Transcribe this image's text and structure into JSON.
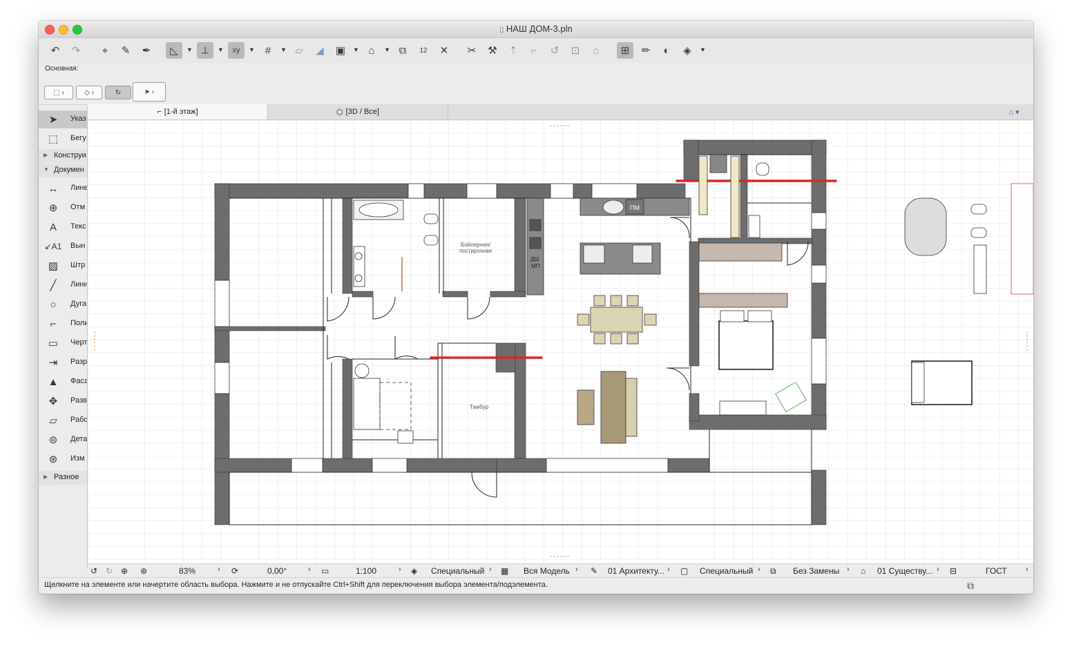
{
  "window": {
    "title": "НАШ ДОМ-3.pln"
  },
  "infobox": {
    "label": "Основная:"
  },
  "toolbox": {
    "items": [
      {
        "label": "Указ"
      },
      {
        "label": "Бегу"
      }
    ],
    "groups": [
      {
        "label": "Конструи"
      },
      {
        "label": "Докумен"
      }
    ],
    "doc_items": [
      {
        "label": "Лине"
      },
      {
        "label": "Отм"
      },
      {
        "label": "Текс"
      },
      {
        "label": "Вын"
      },
      {
        "label": "Штр"
      },
      {
        "label": "Лини"
      },
      {
        "label": "Дуга"
      },
      {
        "label": "Поли"
      },
      {
        "label": "Черт"
      },
      {
        "label": "Разр"
      },
      {
        "label": "Фаса"
      },
      {
        "label": "Разв"
      },
      {
        "label": "Рабо"
      },
      {
        "label": "Дета"
      },
      {
        "label": "Изм"
      }
    ],
    "footer_group": {
      "label": "Разное"
    }
  },
  "tabs": [
    {
      "label": "[1-й этаж]"
    },
    {
      "label": "[3D / Все]"
    }
  ],
  "plan": {
    "labels": {
      "boiler": "Бойлерная/",
      "boiler2": "постирочная",
      "tambur": "Тамбур",
      "pm": "ПМ",
      "dsh": "ДШ",
      "mp": "МП"
    }
  },
  "statusbar": {
    "zoom": "83%",
    "angle": "0,00°",
    "scale": "1:100",
    "layer_combo": "Специальный",
    "model_view": "Вся Модель",
    "pen_set": "01 Архитекту...",
    "display": "Специальный",
    "override": "Без Замены",
    "renovation": "01 Существу...",
    "dim_standard": "ГОСТ"
  },
  "message": {
    "text": "Щелкните на элементе или начертите область выбора. Нажмите и не отпускайте Ctrl+Shift для переключения выбора элемента/подэлемента."
  }
}
